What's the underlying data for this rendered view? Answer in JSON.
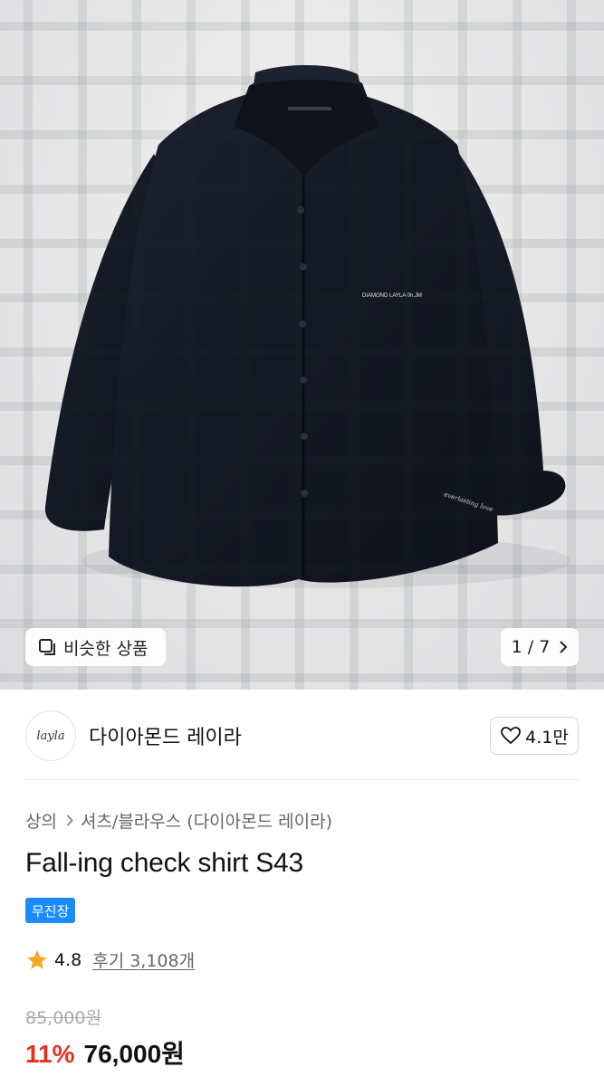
{
  "image": {
    "similar_label": "비슷한 상품",
    "counter": "1 / 7",
    "pocket_print": "DIAMOND LAYLA 0n.JM",
    "cuff_print": "everlasting love"
  },
  "brand": {
    "logo_text": "layla",
    "name": "다이아몬드 레이라",
    "likes": "4.1만"
  },
  "breadcrumb": {
    "category": "상의",
    "subcategory": "셔츠/블라우스 (다이아몬드 레이라)"
  },
  "product": {
    "title": "Fall-ing check shirt S43",
    "badge": "무진장",
    "rating": "4.8",
    "reviews": "후기 3,108개",
    "original_price": "85,000원",
    "discount": "11%",
    "price": "76,000원"
  },
  "colors": {
    "accent_blue": "#1a8cff",
    "discount_red": "#e5301f",
    "star": "#f5a623"
  }
}
